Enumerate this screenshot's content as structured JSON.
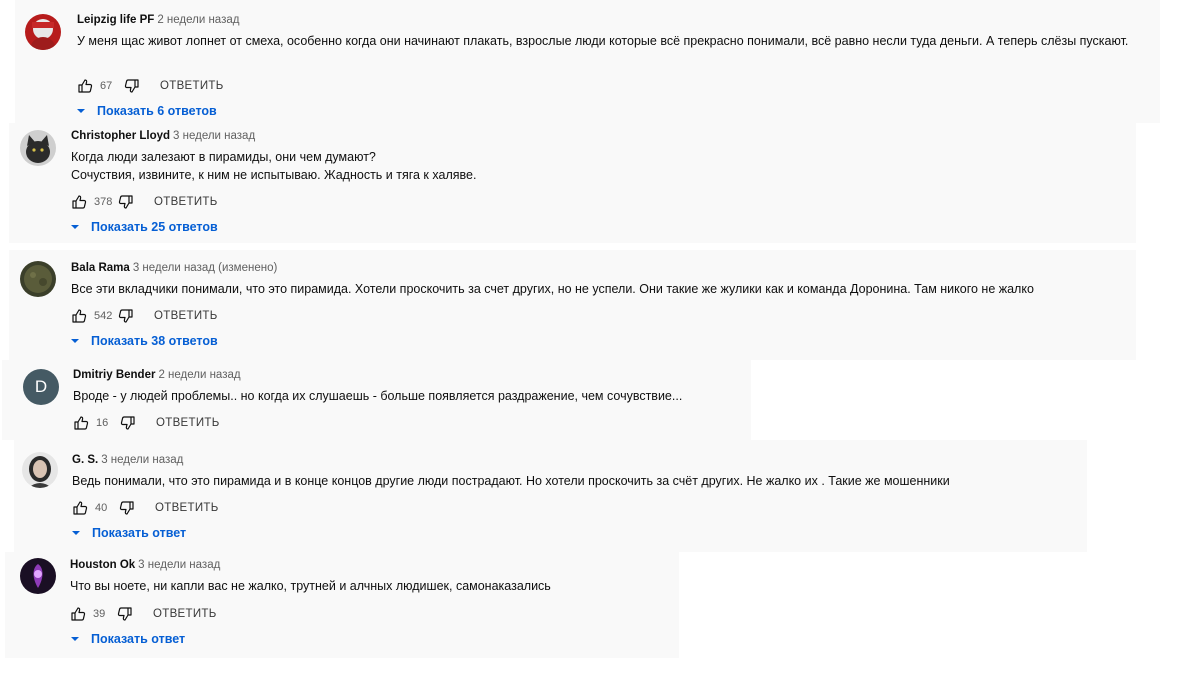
{
  "reply_label": "ОТВЕТИТЬ",
  "colors": {
    "link": "#065fd4",
    "muted": "#606060",
    "card_bg": "#f9f9f9"
  },
  "icons": {
    "like": "thumbs-up-icon",
    "dislike": "thumbs-down-icon",
    "expand": "chevron-down-icon"
  },
  "comments": [
    {
      "author": "Leipzig life PF",
      "time": "2 недели назад",
      "text": "У  меня щас живот лопнет от смеха, особенно когда они начинают плакать,  взрослые люди которые всё прекрасно понимали, всё равно несли туда деньги. А теперь слёзы пускают.",
      "likes": "67",
      "replies": "Показать 6 ответов"
    },
    {
      "author": "Christopher Lloyd",
      "time": "3 недели назад",
      "text_lines": [
        "Когда люди залезают в пирамиды, они чем думают?",
        "Сочуствия, извините, к ним не испытываю. Жадность и тяга к халяве."
      ],
      "likes": "378",
      "replies": "Показать 25 ответов"
    },
    {
      "author": "Bala Rama",
      "time": "3 недели назад (изменено)",
      "text": "Все эти вкладчики понимали, что это пирамида.  Хотели проскочить за счет других, но не успели.  Они такие же жулики как и команда  Доронина.  Там никого не жалко",
      "likes": "542",
      "replies": "Показать 38 ответов"
    },
    {
      "author": "Dmitriy Bender",
      "time": "2 недели назад",
      "avatar_letter": "D",
      "text": "Вроде - у людей проблемы.. но когда их слушаешь - больше появляется раздражение, чем сочувствие...",
      "likes": "16"
    },
    {
      "author": "G. S.",
      "time": "3 недели назад",
      "text": "Ведь понимали, что это пирамида и в конце концов  другие люди пострадают. Но хотели проскочить за счёт  других. Не жалко их . Такие же  мошенники",
      "likes": "40",
      "replies": "Показать ответ"
    },
    {
      "author": "Houston Ok",
      "time": "3 недели назад",
      "text": "Что вы ноете, ни капли вас не жалко, трутней и алчных людишек, самонаказались",
      "likes": "39",
      "replies": "Показать ответ"
    }
  ]
}
